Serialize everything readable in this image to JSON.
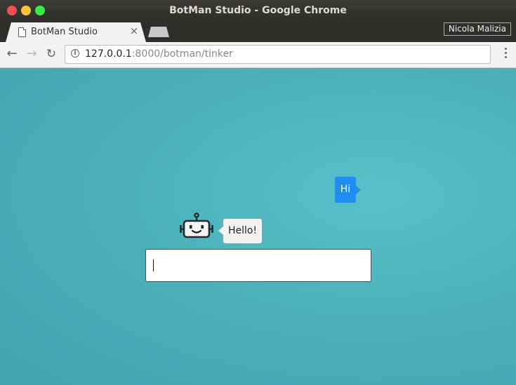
{
  "window": {
    "title": "BotMan Studio - Google Chrome",
    "profile_name": "Nicola Malizia"
  },
  "tabs": [
    {
      "title": "BotMan Studio",
      "icon": "page-icon",
      "close_glyph": "×"
    }
  ],
  "toolbar": {
    "back_glyph": "←",
    "forward_glyph": "→",
    "reload_glyph": "↻",
    "url_host": "127.0.0.1",
    "url_rest": ":8000/botman/tinker"
  },
  "chat": {
    "messages": [
      {
        "from": "user",
        "text": "Hi"
      },
      {
        "from": "bot",
        "text": "Hello!"
      }
    ],
    "input_value": "",
    "colors": {
      "background": "#4cb1bb",
      "user_bubble": "#1f8ef1",
      "bot_bubble": "#f2f2f2"
    }
  }
}
